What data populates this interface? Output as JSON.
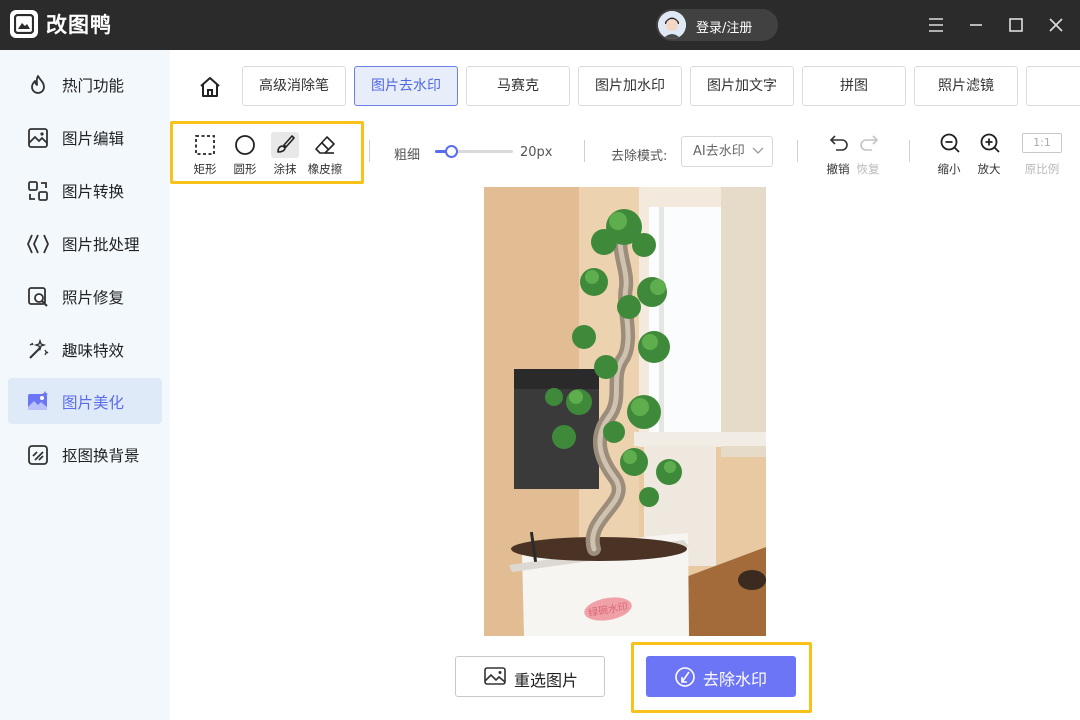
{
  "app": {
    "title": "改图鸭",
    "login_label": "登录/注册"
  },
  "window_controls": {
    "menu": "menu-icon",
    "minimize": "minimize-icon",
    "maximize": "maximize-icon",
    "close": "close-icon"
  },
  "sidebar": {
    "items": [
      {
        "label": "热门功能",
        "icon": "flame-icon"
      },
      {
        "label": "图片编辑",
        "icon": "image-edit-icon"
      },
      {
        "label": "图片转换",
        "icon": "convert-icon"
      },
      {
        "label": "图片批处理",
        "icon": "batch-icon"
      },
      {
        "label": "照片修复",
        "icon": "photo-repair-icon"
      },
      {
        "label": "趣味特效",
        "icon": "magic-wand-icon"
      },
      {
        "label": "图片美化",
        "icon": "image-beautify-icon"
      },
      {
        "label": "抠图换背景",
        "icon": "cutout-icon"
      }
    ],
    "active_index": 6
  },
  "tabs": {
    "items": [
      {
        "label": "高级消除笔"
      },
      {
        "label": "图片去水印"
      },
      {
        "label": "马赛克"
      },
      {
        "label": "图片加水印"
      },
      {
        "label": "图片加文字"
      },
      {
        "label": "拼图"
      },
      {
        "label": "照片滤镜"
      }
    ],
    "active_index": 1
  },
  "tools": {
    "items": [
      {
        "label": "矩形",
        "icon": "rectangle-select-icon"
      },
      {
        "label": "圆形",
        "icon": "circle-select-icon"
      },
      {
        "label": "涂抹",
        "icon": "brush-icon"
      },
      {
        "label": "橡皮擦",
        "icon": "eraser-icon"
      }
    ],
    "active_index": 2
  },
  "brush": {
    "label": "粗细",
    "value_text": "20px",
    "level": 0.2
  },
  "mode": {
    "label": "去除模式:",
    "selected": "AI去水印"
  },
  "history": {
    "undo": "撤销",
    "redo": "恢复"
  },
  "zoom": {
    "zoom_out": "缩小",
    "zoom_in": "放大",
    "ratio_box": "1:1",
    "ratio_label": "原比例"
  },
  "watermark_text": "绿碗水印",
  "actions": {
    "reselect": "重选图片",
    "remove": "去除水印"
  },
  "colors": {
    "accent": "#6c75f5",
    "highlight": "#f8c21a",
    "sidebar_bg": "#f3f8fd",
    "titlebar": "#2b2b2b"
  }
}
